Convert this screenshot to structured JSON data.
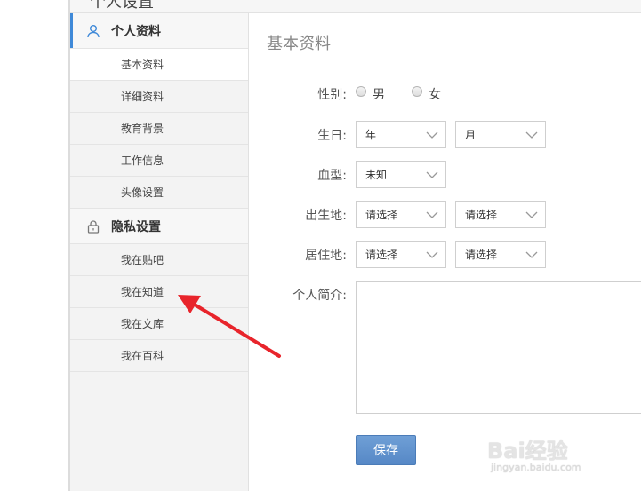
{
  "header": {
    "title": "个人设置"
  },
  "sidebar": {
    "section1": {
      "label": "个人资料",
      "icon": "user-icon",
      "items": [
        "基本资料",
        "详细资料",
        "教育背景",
        "工作信息",
        "头像设置"
      ]
    },
    "section2": {
      "label": "隐私设置",
      "icon": "lock-icon",
      "items": [
        "我在贴吧",
        "我在知道",
        "我在文库",
        "我在百科"
      ]
    }
  },
  "main": {
    "title": "基本资料",
    "gender": {
      "label": "性别:",
      "male": "男",
      "female": "女"
    },
    "birthday": {
      "label": "生日:",
      "year": "年",
      "month": "月"
    },
    "blood": {
      "label": "血型:",
      "value": "未知"
    },
    "birthplace": {
      "label": "出生地:",
      "province": "请选择",
      "city": "请选择"
    },
    "residence": {
      "label": "居住地:",
      "province": "请选择",
      "city": "请选择"
    },
    "bio": {
      "label": "个人简介:"
    },
    "save_label": "保存"
  },
  "watermark": {
    "brand": "Bai经验",
    "url": "jingyan.baidu.com"
  },
  "colors": {
    "accent": "#3f89d8",
    "button": "#5f91cd",
    "arrow": "#e8242b"
  }
}
